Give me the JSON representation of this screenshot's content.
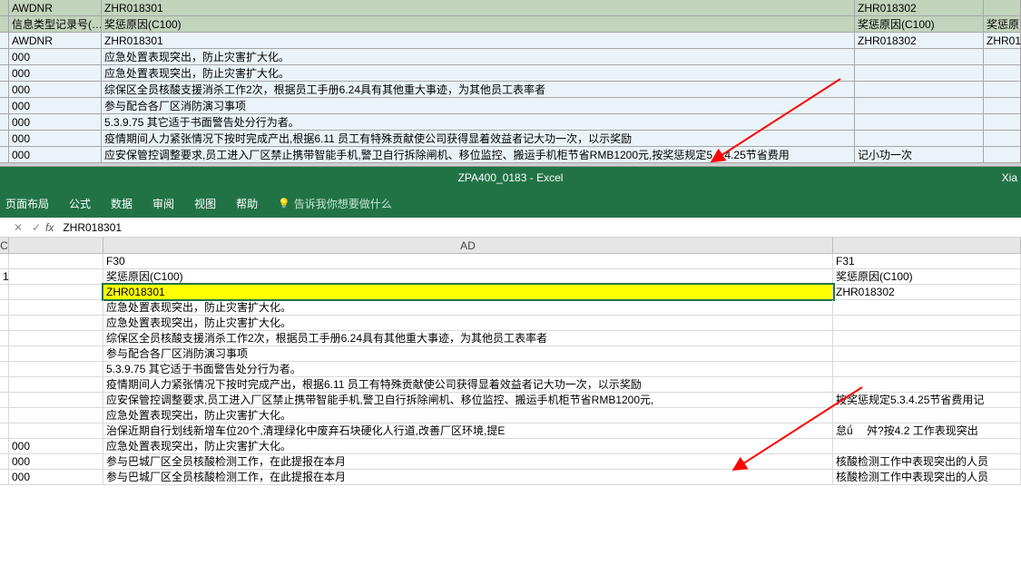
{
  "upper": {
    "header": [
      "",
      "AWDNR",
      "ZHR018301",
      "ZHR018302",
      ""
    ],
    "sub": [
      "",
      "信息类型记录号(…",
      "奖惩原因(C100)",
      "奖惩原因(C100)",
      "奖惩原"
    ],
    "rows": [
      [
        "",
        "AWDNR",
        "ZHR018301",
        "ZHR018302",
        "ZHR01"
      ],
      [
        "",
        "000",
        "应急处置表现突出，防止灾害扩大化。",
        "",
        ""
      ],
      [
        "",
        "000",
        "应急处置表现突出，防止灾害扩大化。",
        "",
        ""
      ],
      [
        "",
        "000",
        "综保区全员核酸支援消杀工作2次，根据员工手册6.24具有其他重大事迹，为其他员工表率者",
        "",
        ""
      ],
      [
        "",
        "000",
        "参与配合各厂区消防演习事项",
        "",
        ""
      ],
      [
        "",
        "000",
        "5.3.9.75 其它适于书面警告处分行为者。",
        "",
        ""
      ],
      [
        "",
        "000",
        "疫情期间人力紧张情况下按时完成产出,根据6.11 员工有特殊贡献使公司获得显着效益者记大功一次，以示奖励",
        "",
        ""
      ],
      [
        "",
        "000",
        "应安保管控调整要求,员工进入厂区禁止携带智能手机,警卫自行拆除闸机、移位监控、搬运手机柜节省RMB1200元,按奖惩规定5.3.4.25节省费用",
        "记小功一次",
        ""
      ]
    ]
  },
  "excel": {
    "title": "ZPA400_0183  -  Excel",
    "user": "Xia",
    "tabs": [
      "页面布局",
      "公式",
      "数据",
      "审阅",
      "视图",
      "帮助"
    ],
    "tell": "告诉我你想要做什么",
    "fx_value": "ZHR018301",
    "cancel": "✕",
    "enter": "✓",
    "fx": "fx",
    "columns": [
      "C",
      "",
      "AD",
      ""
    ],
    "rows": [
      [
        "",
        "",
        "F30",
        "F31"
      ],
      [
        "1",
        "",
        "奖惩原因(C100)",
        "奖惩原因(C100)"
      ],
      [
        "",
        "",
        "ZHR018301",
        "ZHR018302"
      ],
      [
        "",
        "",
        "应急处置表现突出，防止灾害扩大化。",
        ""
      ],
      [
        "",
        "",
        "应急处置表现突出，防止灾害扩大化。",
        ""
      ],
      [
        "",
        "",
        "综保区全员核酸支援消杀工作2次，根据员工手册6.24具有其他重大事迹，为其他员工表率者",
        ""
      ],
      [
        "",
        "",
        "参与配合各厂区消防演习事项",
        ""
      ],
      [
        "",
        "",
        "5.3.9.75 其它适于书面警告处分行为者。",
        ""
      ],
      [
        "",
        "",
        "疫情期间人力紧张情况下按时完成产出，根据6.11 员工有特殊贡献使公司获得显着效益者记大功一次，以示奖励",
        ""
      ],
      [
        "",
        "",
        "应安保管控调整要求,员工进入厂区禁止携带智能手机,警卫自行拆除闸机、移位监控、搬运手机柜节省RMB1200元,",
        "按奖惩规定5.3.4.25节省费用记"
      ],
      [
        "",
        "",
        "应急处置表现突出，防止灾害扩大化。",
        ""
      ],
      [
        "",
        "",
        "治保近期自行划线新增车位20个,清理绿化中废弃石块硬化人行道,改善厂区环境,提E",
        "怠ǘ　 舛?按4.2 工作表现突出"
      ],
      [
        "",
        "000",
        "应急处置表现突出，防止灾害扩大化。",
        ""
      ],
      [
        "",
        "000",
        "参与巴城厂区全员核酸检测工作，在此提报在本月",
        "核酸检测工作中表现突出的人员"
      ],
      [
        "",
        "000",
        "参与巴城厂区全员核酸检测工作，在此提报在本月",
        "核酸检测工作中表现突出的人员"
      ]
    ]
  }
}
